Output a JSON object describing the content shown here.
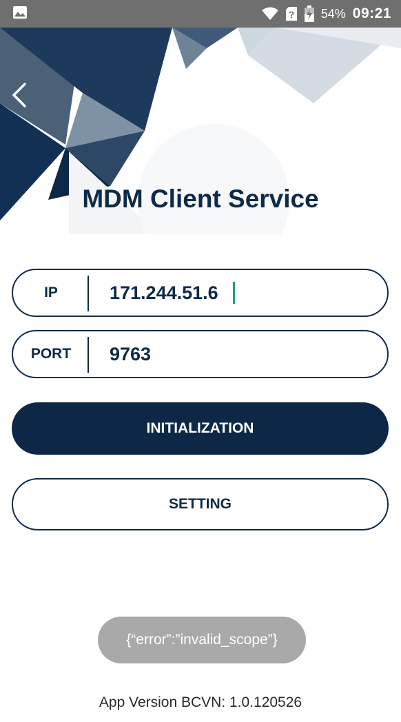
{
  "status_bar": {
    "battery_percent": "54%",
    "time": "09:21",
    "icons": [
      "image-notification-icon",
      "wifi-icon",
      "no-sim-icon",
      "battery-charging-icon"
    ]
  },
  "header": {
    "title": "MDM Client Service",
    "back_icon": "chevron-left-icon"
  },
  "form": {
    "ip": {
      "label": "IP",
      "value": "171.244.51.6"
    },
    "port": {
      "label": "PORT",
      "value": "9763"
    }
  },
  "buttons": {
    "initialization": "INITIALIZATION",
    "setting": "SETTING"
  },
  "toast": {
    "message": "{“error”:”invalid_scope”}"
  },
  "footer": {
    "app_version": "App Version BCVN: 1.0.120526"
  },
  "colors": {
    "primary": "#0d2746",
    "status_bar": "#6f6f6f",
    "toast": "#a9a9a9",
    "caret": "#1a9c8c"
  }
}
